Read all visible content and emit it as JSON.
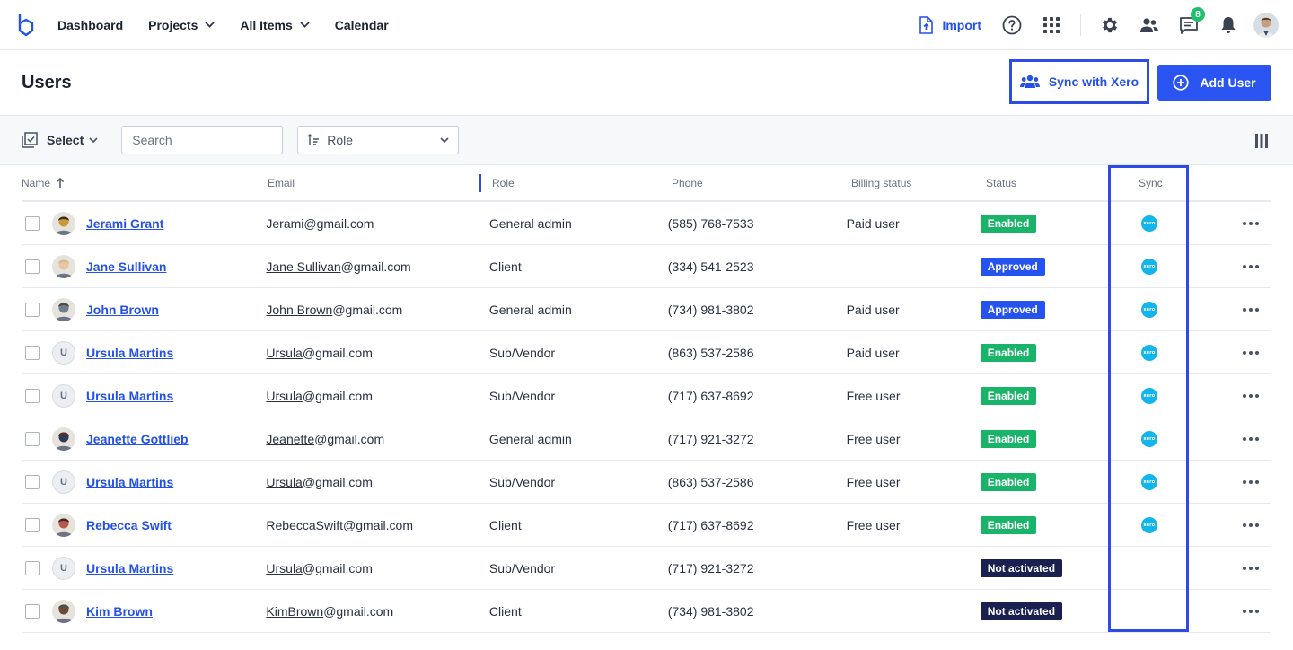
{
  "nav": {
    "items": [
      {
        "label": "Dashboard",
        "has_dropdown": false
      },
      {
        "label": "Projects",
        "has_dropdown": true
      },
      {
        "label": "All Items",
        "has_dropdown": true
      },
      {
        "label": "Calendar",
        "has_dropdown": false
      }
    ],
    "import_label": "Import",
    "notification_count": "8",
    "icons": [
      "help-icon",
      "apps-grid-icon",
      "settings-icon",
      "users-icon",
      "messages-icon",
      "bell-icon",
      "user-avatar"
    ]
  },
  "header": {
    "title": "Users",
    "sync_label": "Sync with Xero",
    "add_label": "Add User"
  },
  "toolbar": {
    "select_label": "Select",
    "search_placeholder": "Search",
    "role_label": "Role"
  },
  "table": {
    "columns": [
      "Name",
      "Email",
      "Role",
      "Phone",
      "Billing status",
      "Status",
      "Sync"
    ],
    "rows": [
      {
        "name": "Jerami Grant",
        "email_user": "",
        "email_rest": "Jerami@gmail.com",
        "role": "General admin",
        "phone": "(585) 768-7533",
        "billing": "Paid user",
        "status": "Enabled",
        "status_kind": "enabled",
        "sync": true,
        "avatar": "photo",
        "avatar_color": "#c99a3c"
      },
      {
        "name": "Jane Sullivan",
        "email_user": "Jane Sullivan",
        "email_rest": "@gmail.com",
        "role": "Client",
        "phone": "(334) 541-2523",
        "billing": "",
        "status": "Approved",
        "status_kind": "approved",
        "sync": true,
        "avatar": "photo",
        "avatar_color": "#e8c6a4"
      },
      {
        "name": "John Brown",
        "email_user": "John Brown",
        "email_rest": "@gmail.com",
        "role": "General admin",
        "phone": "(734) 981-3802",
        "billing": "Paid user",
        "status": "Approved",
        "status_kind": "approved",
        "sync": true,
        "avatar": "photo",
        "avatar_color": "#6f7d8c"
      },
      {
        "name": "Ursula Martins",
        "email_user": "Ursula",
        "email_rest": "@gmail.com",
        "role": "Sub/Vendor",
        "phone": "(863) 537-2586",
        "billing": "Paid user",
        "status": "Enabled",
        "status_kind": "enabled",
        "sync": true,
        "avatar": "U",
        "avatar_color": ""
      },
      {
        "name": "Ursula Martins",
        "email_user": "Ursula",
        "email_rest": "@gmail.com",
        "role": "Sub/Vendor",
        "phone": "(717) 637-8692",
        "billing": "Free user",
        "status": "Enabled",
        "status_kind": "enabled",
        "sync": true,
        "avatar": "U",
        "avatar_color": ""
      },
      {
        "name": "Jeanette Gottlieb",
        "email_user": "Jeanette",
        "email_rest": "@gmail.com",
        "role": "General admin",
        "phone": "(717) 921-3272",
        "billing": "Free user",
        "status": "Enabled",
        "status_kind": "enabled",
        "sync": true,
        "avatar": "photo",
        "avatar_color": "#2d3a55"
      },
      {
        "name": "Ursula Martins",
        "email_user": "Ursula",
        "email_rest": "@gmail.com",
        "role": "Sub/Vendor",
        "phone": "(863) 537-2586",
        "billing": "Free user",
        "status": "Enabled",
        "status_kind": "enabled",
        "sync": true,
        "avatar": "U",
        "avatar_color": ""
      },
      {
        "name": "Rebecca Swift",
        "email_user": "RebeccaSwift",
        "email_rest": "@gmail.com",
        "role": "Client",
        "phone": "(717) 637-8692",
        "billing": "Free user",
        "status": "Enabled",
        "status_kind": "enabled",
        "sync": true,
        "avatar": "photo",
        "avatar_color": "#b8584a"
      },
      {
        "name": "Ursula Martins",
        "email_user": "Ursula",
        "email_rest": "@gmail.com",
        "role": "Sub/Vendor",
        "phone": "(717) 921-3272",
        "billing": "",
        "status": "Not activated",
        "status_kind": "notact",
        "sync": false,
        "avatar": "U",
        "avatar_color": ""
      },
      {
        "name": "Kim Brown",
        "email_user": "KimBrown",
        "email_rest": "@gmail.com",
        "role": "Client",
        "phone": "(734) 981-3802",
        "billing": "",
        "status": "Not activated",
        "status_kind": "notact",
        "sync": false,
        "avatar": "photo",
        "avatar_color": "#6b4a3a"
      }
    ]
  },
  "colors": {
    "accent": "#2451e6",
    "highlight": "#2d4be5",
    "enabled": "#19b46a",
    "approved": "#2653f0",
    "not_activated": "#1a2150",
    "xero": "#13b5ea"
  },
  "xero_logo_text": "xero"
}
